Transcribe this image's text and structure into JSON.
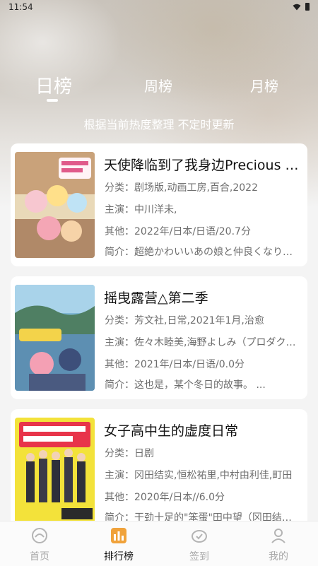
{
  "status_bar": {
    "time": "11:54"
  },
  "tabs": [
    {
      "label": "日榜",
      "active": true
    },
    {
      "label": "周榜",
      "active": false
    },
    {
      "label": "月榜",
      "active": false
    }
  ],
  "subtitle": "根据当前热度整理 不定时更新",
  "items": [
    {
      "title": "天使降临到了我身边Precious Friends",
      "category": "分类：剧场版,动画工房,百合,2022",
      "cast": "主演：中川洋未,",
      "other": "其他：2022年/日本/日语/20.7分",
      "intro": "简介：超絶かわいいあの娘と仲良くなりたい"
    },
    {
      "title": "摇曳露营△第二季",
      "category": "分类：芳文社,日常,2021年1月,治愈",
      "cast": "主演：佐々木睦美,海野よしみ（プロダクション）",
      "other": "其他：2021年/日本/日语/0.0分",
      "intro": "简介：这也是，某个冬日的故事。 ..."
    },
    {
      "title": "女子高中生的虚度日常",
      "category": "分类：日剧",
      "cast": "主演：冈田结实,恒松祐里,中村由利佳,町田",
      "other": "其他：2020年/日本//6.0分",
      "intro": "简介：干劲十足的\"笨蛋\"田中望（冈田结实）"
    }
  ],
  "bottom_nav": [
    {
      "label": "首页",
      "icon": "home-icon",
      "active": false
    },
    {
      "label": "排行榜",
      "icon": "ranking-icon",
      "active": true
    },
    {
      "label": "签到",
      "icon": "checkin-icon",
      "active": false
    },
    {
      "label": "我的",
      "icon": "profile-icon",
      "active": false
    }
  ],
  "colors": {
    "active_icon": "#f0a23a",
    "inactive": "#a8a8a8",
    "text": "#111111"
  }
}
